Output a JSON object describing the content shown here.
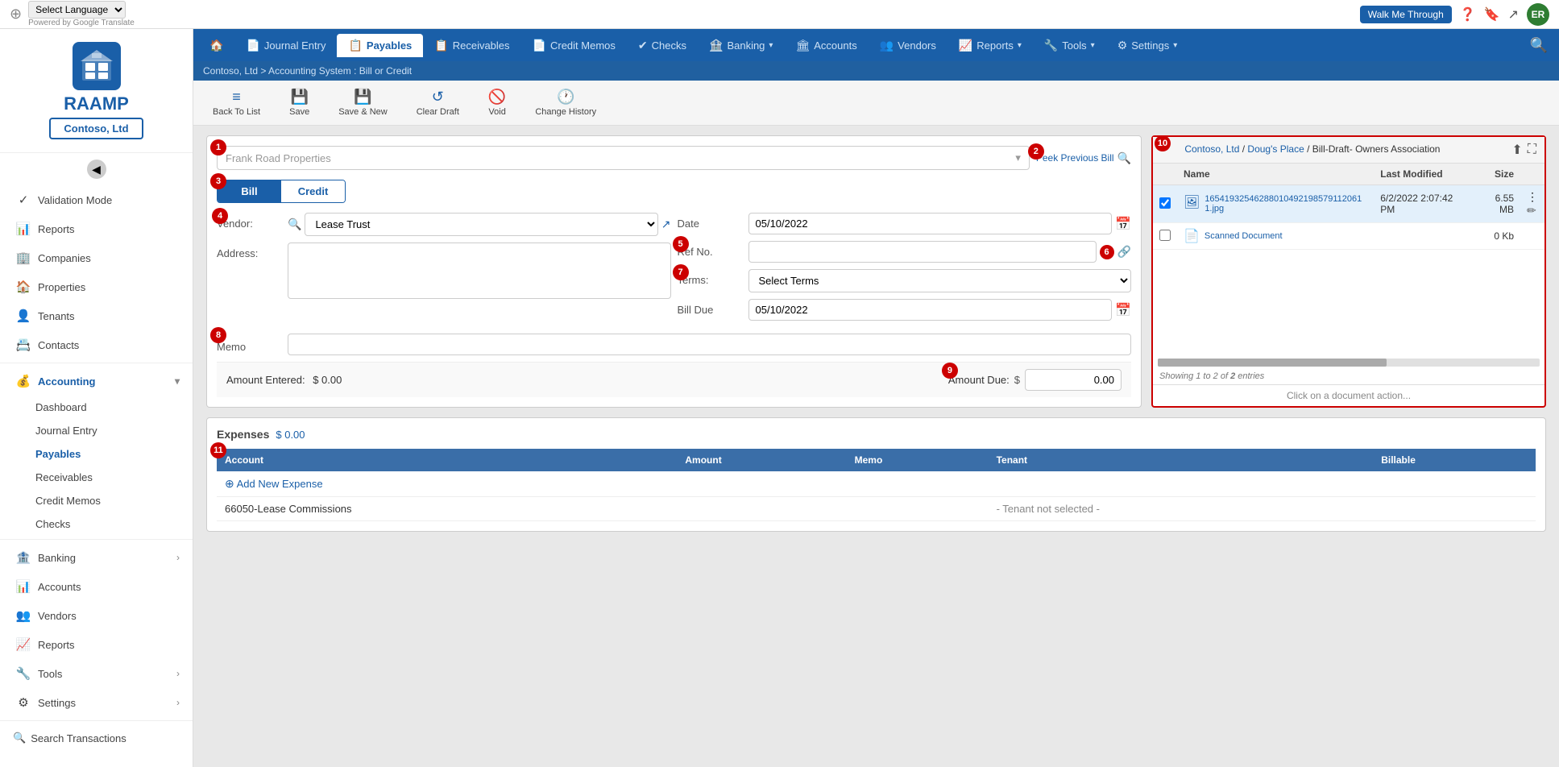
{
  "topbar": {
    "lang_select_value": "Select Language",
    "google_translate": "Powered by Google Translate",
    "walk_me_through": "Walk Me Through",
    "avatar_initials": "ER"
  },
  "breadcrumb": "Contoso, Ltd > Accounting System : Bill or Credit",
  "nav_tabs": [
    {
      "id": "home",
      "label": "",
      "icon": "🏠",
      "active": false
    },
    {
      "id": "journal-entry",
      "label": "Journal Entry",
      "icon": "📄",
      "active": false
    },
    {
      "id": "payables",
      "label": "Payables",
      "icon": "📋",
      "active": true
    },
    {
      "id": "receivables",
      "label": "Receivables",
      "icon": "📋",
      "active": false
    },
    {
      "id": "credit-memos",
      "label": "Credit Memos",
      "icon": "📄",
      "active": false
    },
    {
      "id": "checks",
      "label": "Checks",
      "icon": "✔",
      "active": false
    },
    {
      "id": "banking",
      "label": "Banking",
      "icon": "🏦",
      "active": false,
      "has_arrow": true
    },
    {
      "id": "accounts",
      "label": "Accounts",
      "icon": "📊",
      "active": false
    },
    {
      "id": "vendors",
      "label": "Vendors",
      "icon": "👥",
      "active": false
    },
    {
      "id": "reports",
      "label": "Reports",
      "icon": "📈",
      "active": false,
      "has_arrow": true
    },
    {
      "id": "tools",
      "label": "Tools",
      "icon": "🔧",
      "active": false,
      "has_arrow": true
    },
    {
      "id": "settings",
      "label": "Settings",
      "icon": "⚙",
      "active": false,
      "has_arrow": true
    }
  ],
  "toolbar": {
    "back_to_list": "Back To List",
    "save": "Save",
    "save_and_new": "Save & New",
    "clear_draft": "Clear Draft",
    "void": "Void",
    "change_history": "Change History"
  },
  "form": {
    "vendor_placeholder": "Frank Road Properties",
    "peek_previous_bill": "Peek Previous Bill",
    "bill_label": "Bill",
    "credit_label": "Credit",
    "vendor_label": "Vendor:",
    "vendor_value": "Lease Trust",
    "address_label": "Address:",
    "address_value": "",
    "date_label": "Date",
    "date_value": "05/10/2022",
    "ref_no_label": "Ref No.",
    "ref_no_value": "",
    "terms_label": "Terms:",
    "terms_value": "Select Terms",
    "bill_due_label": "Bill Due",
    "bill_due_value": "05/10/2022",
    "memo_label": "Memo",
    "memo_value": "",
    "amount_entered_label": "Amount Entered:",
    "amount_entered_value": "$ 0.00",
    "amount_due_label": "Amount Due:",
    "amount_due_value": "0.00"
  },
  "documents": {
    "breadcrumb_company": "Contoso, Ltd",
    "breadcrumb_sep1": " / ",
    "breadcrumb_place": "Doug's Place",
    "breadcrumb_sep2": " / ",
    "breadcrumb_doc": "Bill-Draft- Owners Association",
    "col_name": "Name",
    "col_last_modified": "Last Modified",
    "col_size": "Size",
    "files": [
      {
        "name": "165419325462880104921985791120611.jpg",
        "last_modified": "6/2/2022 2:07:42 PM",
        "size": "6.55 MB",
        "type": "jpg",
        "selected": true
      },
      {
        "name": "Scanned Document",
        "last_modified": "",
        "size": "0 Kb",
        "type": "pdf",
        "selected": false
      }
    ],
    "showing_label": "Showing 1 to 2 of",
    "total_count": "2",
    "entries_label": "entries",
    "action_label": "Click on a document action..."
  },
  "expenses": {
    "title": "Expenses",
    "amount": "$ 0.00",
    "cols": [
      "Account",
      "Amount",
      "Memo",
      "Tenant",
      "Billable"
    ],
    "add_expense_label": "Add New Expense",
    "rows": [
      {
        "account": "66050-Lease Commissions",
        "amount": "",
        "memo": "",
        "tenant": "- Tenant not selected -",
        "billable": ""
      }
    ]
  },
  "sidebar": {
    "company": "Contoso, Ltd",
    "logo_text": "RAAMP",
    "items": [
      {
        "id": "validation-mode",
        "label": "Validation Mode",
        "icon": "✓"
      },
      {
        "id": "reports",
        "label": "Reports",
        "icon": "📊"
      },
      {
        "id": "companies",
        "label": "Companies",
        "icon": "🏢"
      },
      {
        "id": "properties",
        "label": "Properties",
        "icon": "🏠"
      },
      {
        "id": "tenants",
        "label": "Tenants",
        "icon": "👤"
      },
      {
        "id": "contacts",
        "label": "Contacts",
        "icon": "📇"
      },
      {
        "id": "accounting",
        "label": "Accounting",
        "icon": "💰",
        "expanded": true,
        "active": true
      },
      {
        "id": "dashboard",
        "label": "Dashboard",
        "icon": "📊",
        "sub": true
      },
      {
        "id": "journal-entry",
        "label": "Journal Entry",
        "icon": "📄",
        "sub": true
      },
      {
        "id": "payables",
        "label": "Payables",
        "icon": "📋",
        "sub": true,
        "active": true
      },
      {
        "id": "receivables",
        "label": "Receivables",
        "icon": "📋",
        "sub": true
      },
      {
        "id": "credit-memos",
        "label": "Credit Memos",
        "icon": "📄",
        "sub": true
      },
      {
        "id": "checks",
        "label": "Checks",
        "icon": "✔",
        "sub": true
      },
      {
        "id": "banking",
        "label": "Banking",
        "icon": "🏦",
        "has_arrow": true
      },
      {
        "id": "accounts",
        "label": "Accounts",
        "icon": "📊"
      },
      {
        "id": "vendors",
        "label": "Vendors",
        "icon": "👥"
      },
      {
        "id": "reports2",
        "label": "Reports",
        "icon": "📈"
      },
      {
        "id": "tools",
        "label": "Tools",
        "icon": "🔧",
        "has_arrow": true
      },
      {
        "id": "settings",
        "label": "Settings",
        "icon": "⚙",
        "has_arrow": true
      }
    ],
    "search": "Search Transactions"
  },
  "step_numbers": {
    "s1": "1",
    "s2": "2",
    "s3": "3",
    "s4": "4",
    "s5": "5",
    "s6": "6",
    "s7": "7",
    "s8": "8",
    "s9": "9",
    "s10": "10",
    "s11": "11"
  }
}
